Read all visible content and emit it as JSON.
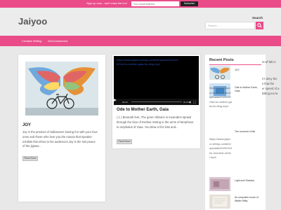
{
  "topbar": {
    "message": "Sign up now - don't miss the fun!",
    "email_placeholder": "Your email address",
    "subscribe_label": "Subscribe"
  },
  "header": {
    "site_title": "Jaiyoo",
    "search_label": "Search",
    "search_placeholder": "Search ..."
  },
  "nav": {
    "items": [
      {
        "label": "Creative Writing"
      },
      {
        "label": "Self-enrichment"
      }
    ]
  },
  "posts": [
    {
      "title": "JOY",
      "excerpt": "Joy in the product of Halloween! having fun with your love ones and those who love you.the eusoia that speaker exhibits this ethos to his audiences.Joy is the lost peace of the jigsaw...",
      "readmore": "Read More"
    },
    {
      "title": "Ode to Mother Earth, Gaia",
      "video_url": "https://www.jaiyoo.net/wp-content/uploads/2020/10/Ode-to-mother-gaia-for-blog.mp4",
      "video_time_left": "00:00",
      "video_time_right": "00:00",
      "excerpt": "( 1 ) Beneath feet, The green ribbons in meanders sprawl through the face of Erebus resting in the arms of Morpheus to omphalus of Gaia. You blow a fizz kiss and...",
      "readmore": "Read More"
    }
  ],
  "sidebar": {
    "title": "Recent Posts",
    "items": [
      {
        "label": "JOY"
      },
      {
        "label": "Ode to Mother Earth, Gaia"
      },
      {
        "label": "The moment of fall"
      },
      {
        "label": "Light and Shadow"
      },
      {
        "label": "An unspoken muse of Walter Mitty"
      }
    ],
    "url_text_1": "https://www.jaiyoo.net/wp-content/uploads/2020/10/Ode-to-mother-gaia-for-blog.mp4",
    "url_text_2": "https://www.jaiyoo.net/wp-content/uploads/2020/10/the-moment-of-fall.mp4"
  },
  "overflow_text": {
    "line1": "nt-of-fall.m",
    "line2": "n't deny the",
    "line3": "s that the",
    "line4": "er speed of a",
    "line5": "falling too la"
  },
  "colors": {
    "accent": "#ea4c89",
    "background": "#e8e8e8"
  }
}
